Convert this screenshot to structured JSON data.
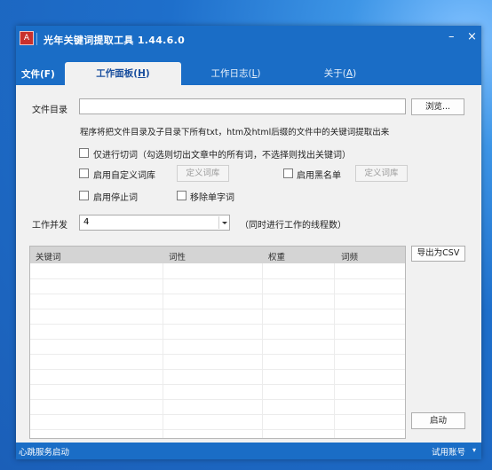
{
  "window": {
    "title": "光年关键词提取工具 1.44.6.0",
    "minimize": "–",
    "close": "×"
  },
  "menu": {
    "file": "文件(F)",
    "tabs": [
      {
        "label": "工作面板(",
        "key": "H",
        "suffix": ")"
      },
      {
        "label": "工作日志(",
        "key": "L",
        "suffix": ")"
      },
      {
        "label": "关于(",
        "key": "A",
        "suffix": ")"
      }
    ]
  },
  "form": {
    "dir_label": "文件目录",
    "dir_value": "",
    "browse_button": "浏览...",
    "hint": "程序将把文件目录及子目录下所有txt，htm及html后缀的文件中的关键词提取出来",
    "only_segment": {
      "label": "仅进行切词（勾选则切出文章中的所有词，不选择则找出关键词）",
      "checked": false
    },
    "custom_dict": {
      "label": "启用自定义词库",
      "checked": false
    },
    "custom_dict_button": "定义词库",
    "blacklist": {
      "label": "启用黑名单",
      "checked": false
    },
    "blacklist_button": "定义词库",
    "stopwords": {
      "label": "启用停止词",
      "checked": false
    },
    "remove_single": {
      "label": "移除单字词",
      "checked": false
    },
    "concurrency_label": "工作并发",
    "concurrency_value": "4",
    "concurrency_hint": "（同时进行工作的线程数）"
  },
  "table": {
    "columns": [
      "关键词",
      "词性",
      "权重",
      "词频"
    ],
    "rows": []
  },
  "actions": {
    "export_csv": "导出为CSV",
    "start": "启动"
  },
  "status": {
    "left": "心跳服务启动",
    "right": "试用账号",
    "dropdown": "▾"
  }
}
